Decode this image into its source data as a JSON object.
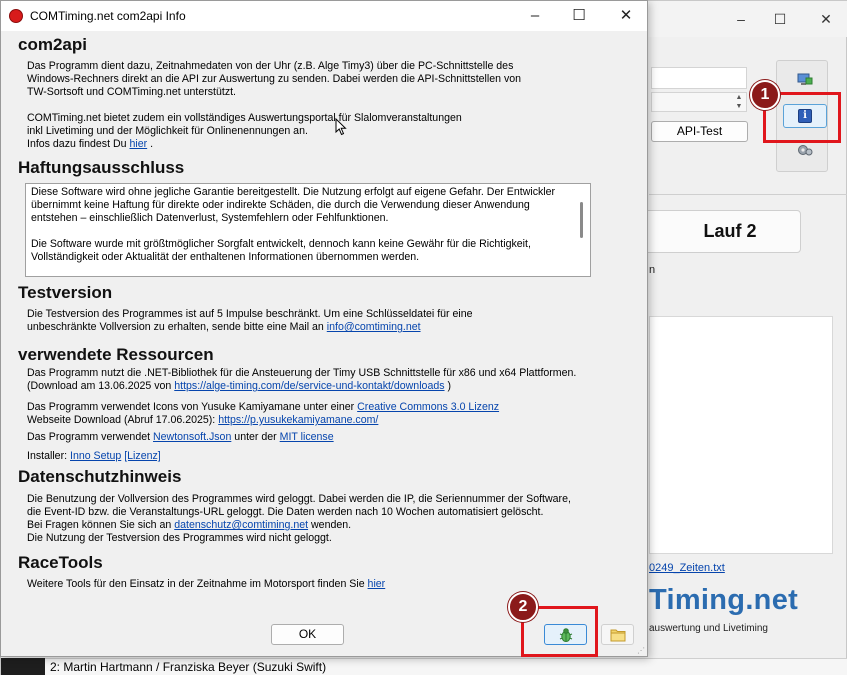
{
  "dialog": {
    "title": "COMTiming.net com2api Info",
    "sections": {
      "com2api": {
        "heading": "com2api",
        "p1_l1": "Das Programm dient dazu, Zeitnahmedaten von der Uhr (z.B. Alge Timy3) über die PC-Schnittstelle des",
        "p1_l2": "Windows-Rechners direkt an die API zur Auswertung zu senden. Dabei werden die API-Schnittstellen von",
        "p1_l3": "TW-Sortsoft und COMTiming.net unterstützt.",
        "p2_l1": "COMTiming.net bietet zudem ein vollständiges Auswertungsportal für Slalomveranstaltungen",
        "p2_l2": "inkl Livetiming und der Möglichkeit für Onlinenennungen an.",
        "p2_l3_prefix": "Infos dazu findest Du",
        "p2_link": "hier",
        "p2_suffix": "."
      },
      "disclaimer": {
        "heading": "Haftungsausschluss",
        "l1": "Diese Software wird ohne jegliche Garantie bereitgestellt. Die Nutzung erfolgt auf eigene Gefahr. Der Entwickler",
        "l2": "übernimmt keine Haftung für direkte oder indirekte Schäden, die durch die Verwendung dieser Anwendung",
        "l3": "entstehen – einschließlich Datenverlust, Systemfehlern oder Fehlfunktionen.",
        "l4": "Die Software wurde mit größtmöglicher Sorgfalt entwickelt, dennoch kann keine Gewähr für die Richtigkeit,",
        "l5": "Vollständigkeit oder Aktualität der enthaltenen Informationen übernommen werden."
      },
      "testversion": {
        "heading": "Testversion",
        "l1": "Die Testversion des Programmes ist auf 5 Impulse beschränkt. Um eine Schlüsseldatei für eine",
        "l2_prefix": "unbeschränkte Vollversion zu erhalten, sende bitte eine Mail an",
        "l2_link": "info@comtiming.net"
      },
      "resources": {
        "heading": "verwendete Ressourcen",
        "r1_l1": "Das Programm nutzt die .NET-Bibliothek für die Ansteuerung der Timy USB Schnittstelle für x86 und x64 Plattformen.",
        "r1_l2_prefix": "(Download am 13.06.2025 von",
        "r1_l2_link": "https://alge-timing.com/de/service-und-kontakt/downloads",
        "r1_l2_suffix": ")",
        "r2_l1_prefix": "Das Programm verwendet Icons von Yusuke Kamiyamane unter einer",
        "r2_l1_link": "Creative Commons 3.0 Lizenz",
        "r2_l2_prefix": "Webseite  Download (Abruf 17.06.2025):",
        "r2_l2_link": "https://p.yusukekamiyamane.com/",
        "r3_prefix": "Das Programm verwendet",
        "r3_link1": "Newtonsoft.Json",
        "r3_mid": "unter der",
        "r3_link2": "MIT license",
        "r4_prefix": "Installer:",
        "r4_link1": "Inno Setup",
        "r4_link2": "[Lizenz]"
      },
      "privacy": {
        "heading": "Datenschutzhinweis",
        "l1": "Die Benutzung der Vollversion des Programmes wird geloggt. Dabei werden die IP, die Seriennummer der Software,",
        "l2": "die Event-ID bzw. die Veranstaltungs-URL geloggt. Die Daten werden nach 10 Wochen automatisiert gelöscht.",
        "l3_prefix": "Bei Fragen können Sie sich an",
        "l3_link": "datenschutz@comtiming.net",
        "l3_suffix": "wenden.",
        "l4": "Die Nutzung der Testversion des Programmes wird nicht geloggt."
      },
      "racetools": {
        "heading": "RaceTools",
        "l1_prefix": "Weitere Tools für den Einsatz in der Zeitnahme im Motorsport finden Sie",
        "l1_link": "hier"
      }
    },
    "ok_label": "OK"
  },
  "background": {
    "api_test_label": "API-Test",
    "lauf2_label": "Lauf 2",
    "label_n": "n",
    "file_link": "0249_Zeiten.txt",
    "brand": "Timing.net",
    "brand_tagline": "auswertung und Livetiming",
    "statusbar": "2: Martin  Hartmann / Franziska  Beyer (Suzuki  Swift)"
  },
  "annotations": {
    "badge_1": "1",
    "badge_2": "2",
    "highlight_color": "#e0161c",
    "badge_color": "#8b1a1a"
  },
  "icons": [
    "network-icon",
    "info-icon",
    "settings-icon",
    "bug-icon",
    "folder-icon",
    "app-icon"
  ]
}
